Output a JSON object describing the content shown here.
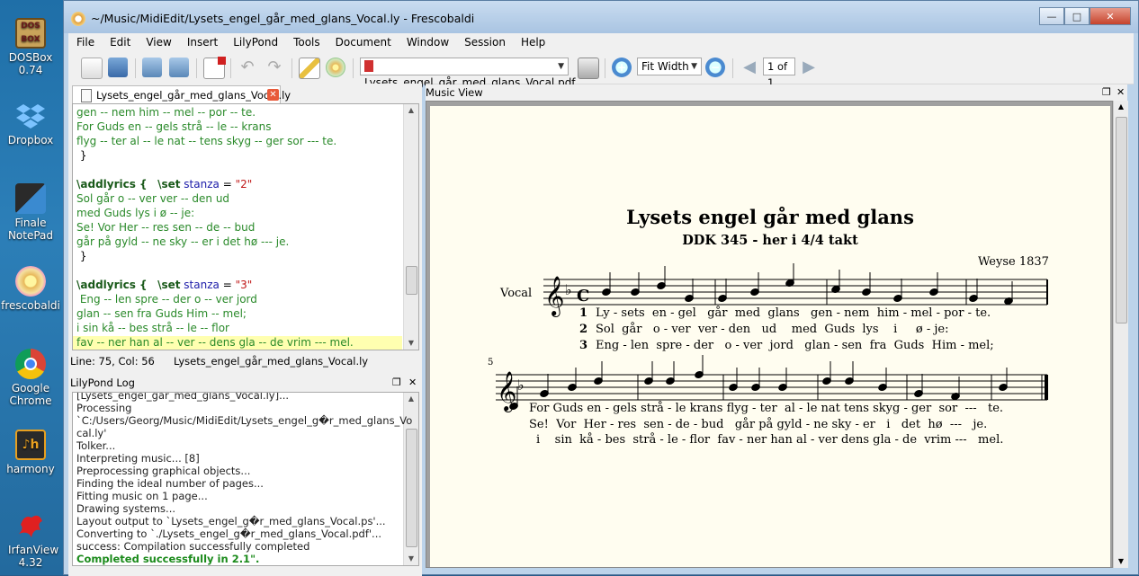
{
  "desktop": {
    "icons": [
      {
        "label": "DOSBox 0.74",
        "icon": "dosbox-icon"
      },
      {
        "label": "Dropbox",
        "icon": "dropbox-icon"
      },
      {
        "label": "Finale NotePad",
        "icon": "finale-icon"
      },
      {
        "label": "frescobaldi",
        "icon": "frescobaldi-icon"
      },
      {
        "label": "Google Chrome",
        "icon": "chrome-icon"
      },
      {
        "label": "harmony",
        "icon": "harmony-icon"
      },
      {
        "label": "IrfanView 4.32",
        "icon": "irfanview-icon"
      }
    ]
  },
  "window": {
    "title": "~/Music/MidiEdit/Lysets_engel_går_med_glans_Vocal.ly - Frescobaldi"
  },
  "menu": [
    "File",
    "Edit",
    "View",
    "Insert",
    "LilyPond",
    "Tools",
    "Document",
    "Window",
    "Session",
    "Help"
  ],
  "toolbar": {
    "pdf_file": "Lysets_engel_går_med_glans_Vocal.pdf",
    "zoom": "Fit Width",
    "page": "1 of 1"
  },
  "editor": {
    "tab_label": "Lysets_engel_går_med_glans_Vocal.ly",
    "lines": [
      {
        "type": "lyr",
        "text": "gen -- nem him -- mel -- por -- te."
      },
      {
        "type": "lyr",
        "text": "For Guds en -- gels strå -- le -- krans"
      },
      {
        "type": "lyr",
        "text": "flyg -- ter al -- le nat -- tens skyg -- ger sor --- te."
      },
      {
        "type": "plain",
        "text": " }"
      },
      {
        "type": "blank",
        "text": ""
      },
      {
        "type": "cmd",
        "cmd": "\\addlyrics {",
        "set": "\\set",
        "ident": "stanza",
        "eq": " = ",
        "str": "\"2\""
      },
      {
        "type": "lyr",
        "text": "Sol går o -- ver ver -- den ud"
      },
      {
        "type": "lyr",
        "text": "med Guds lys i ø -- je:"
      },
      {
        "type": "lyr",
        "text": "Se! Vor Her -- res sen -- de -- bud"
      },
      {
        "type": "lyr",
        "text": "går på gyld -- ne sky -- er i det hø --- je."
      },
      {
        "type": "plain",
        "text": " }"
      },
      {
        "type": "blank",
        "text": ""
      },
      {
        "type": "cmd",
        "cmd": "\\addlyrics {",
        "set": "\\set",
        "ident": "stanza",
        "eq": " = ",
        "str": "\"3\""
      },
      {
        "type": "lyr",
        "text": " Eng -- len spre -- der o -- ver jord"
      },
      {
        "type": "lyr",
        "text": "glan -- sen fra Guds Him -- mel;"
      },
      {
        "type": "lyr",
        "text": "i sin kå -- bes strå -- le -- flor"
      },
      {
        "type": "lyr",
        "text": "fav -- ner han al -- ver -- dens gla -- de vrim --- mel."
      }
    ],
    "status_pos": "Line: 75, Col: 56",
    "status_file": "Lysets_engel_går_med_glans_Vocal.ly"
  },
  "log": {
    "title": "LilyPond Log",
    "lines": [
      {
        "text": "[Lysets_engel_går_med_glans_Vocal.ly]...",
        "ok": false
      },
      {
        "text": "Processing",
        "ok": false
      },
      {
        "text": "`C:/Users/Georg/Music/MidiEdit/Lysets_engel_g�r_med_glans_Vo",
        "ok": false
      },
      {
        "text": "cal.ly'",
        "ok": false
      },
      {
        "text": "Tolker...",
        "ok": false
      },
      {
        "text": "Interpreting music... [8]",
        "ok": false
      },
      {
        "text": "Preprocessing graphical objects...",
        "ok": false
      },
      {
        "text": "Finding the ideal number of pages...",
        "ok": false
      },
      {
        "text": "Fitting music on 1 page...",
        "ok": false
      },
      {
        "text": "Drawing systems...",
        "ok": false
      },
      {
        "text": "Layout output to `Lysets_engel_g�r_med_glans_Vocal.ps'...",
        "ok": false
      },
      {
        "text": "Converting to `./Lysets_engel_g�r_med_glans_Vocal.pdf'...",
        "ok": false
      },
      {
        "text": "success: Compilation successfully completed",
        "ok": false
      },
      {
        "text": "Completed successfully in 2.1\".",
        "ok": true
      }
    ]
  },
  "music_view": {
    "title": "Music View",
    "score_title": "Lysets engel går med glans",
    "subtitle": "DDK 345 - her i 4/4 takt",
    "composer": "Weyse 1837",
    "instrument": "Vocal",
    "bar_number": "5",
    "system1_lyrics": [
      {
        "num": "1",
        "text": "Ly - sets  en - gel   går  med  glans   gen - nem  him - mel - por - te."
      },
      {
        "num": "2",
        "text": "Sol  går   o - ver  ver - den   ud    med  Guds  lys    i     ø - je:"
      },
      {
        "num": "3",
        "text": "Eng - len  spre - der   o - ver  jord   glan - sen  fra  Guds  Him - mel;"
      }
    ],
    "system2_lyrics": [
      "For Guds en - gels strå - le krans flyg - ter  al - le nat tens skyg - ger  sor  ---   te.",
      "Se!  Vor  Her - res  sen - de - bud   går på gyld - ne sky - er   i   det  hø  ---   je.",
      "i    sin  kå - bes  strå - le - flor  fav - ner han al - ver dens gla - de  vrim ---   mel."
    ]
  }
}
